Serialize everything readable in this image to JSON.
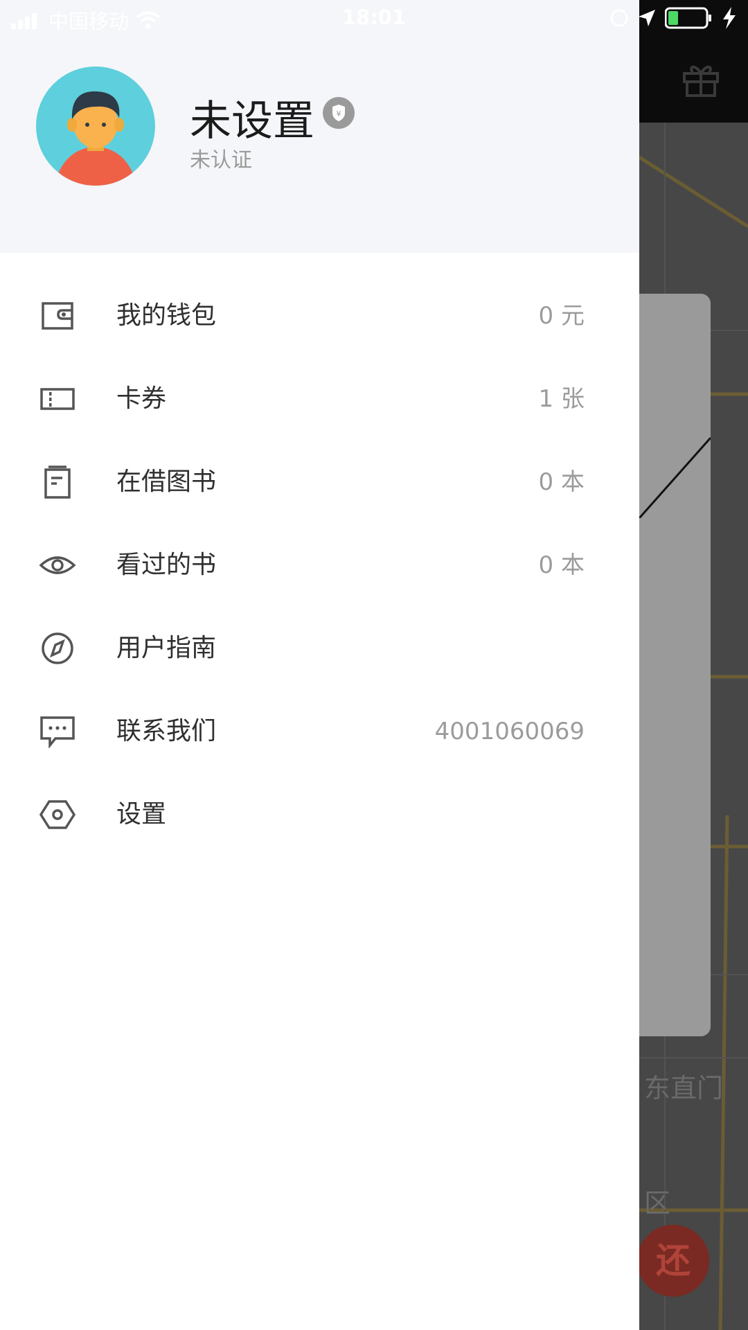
{
  "status_bar": {
    "carrier": "中国移动",
    "time": "18:01"
  },
  "profile": {
    "name": "未设置",
    "auth_status": "未认证",
    "badge_icon": "yen-shield-icon"
  },
  "menu": [
    {
      "icon": "wallet-icon",
      "label": "我的钱包",
      "value": "0 元"
    },
    {
      "icon": "ticket-icon",
      "label": "卡券",
      "value": "1 张"
    },
    {
      "icon": "book-icon",
      "label": "在借图书",
      "value": "0 本"
    },
    {
      "icon": "eye-icon",
      "label": "看过的书",
      "value": "0 本"
    },
    {
      "icon": "compass-icon",
      "label": "用户指南",
      "value": ""
    },
    {
      "icon": "chat-icon",
      "label": "联系我们",
      "value": "4001060069"
    },
    {
      "icon": "settings-hex-icon",
      "label": "设置",
      "value": ""
    }
  ],
  "map": {
    "labels": [
      "东直门",
      "区"
    ],
    "fab_label": "还"
  },
  "colors": {
    "drawer_bg": "#ffffff",
    "profile_bg": "#f5f6f9",
    "avatar_bg": "#5ecfdc",
    "text_primary": "#2f2f2f",
    "text_secondary": "#9b9b9b"
  }
}
